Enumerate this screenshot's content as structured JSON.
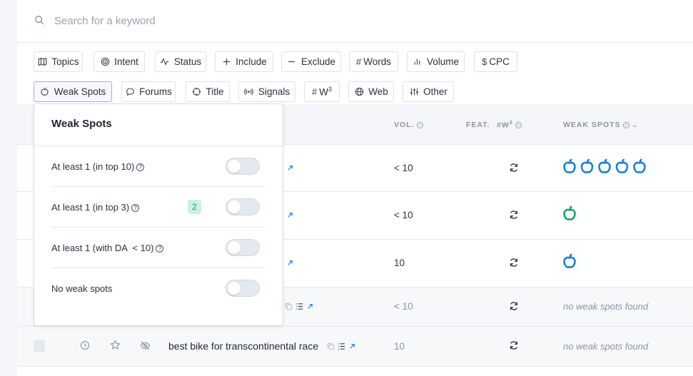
{
  "search": {
    "placeholder": "Search for a keyword"
  },
  "filters_row1": [
    {
      "label": "Topics",
      "icon": "map-icon"
    },
    {
      "label": "Intent",
      "icon": "target-icon"
    },
    {
      "label": "Status",
      "icon": "activity-icon"
    },
    {
      "label": "Include",
      "icon": "plus-icon"
    },
    {
      "label": "Exclude",
      "icon": "minus-icon"
    },
    {
      "label": "Words",
      "icon": "hash-icon"
    },
    {
      "label": "Volume",
      "icon": "bar-chart-icon"
    },
    {
      "label": "CPC",
      "icon": "dollar-icon"
    }
  ],
  "filters_row2": [
    {
      "label": "Weak Spots",
      "icon": "apple-icon"
    },
    {
      "label": "Forums",
      "icon": "chat-bubble-icon"
    },
    {
      "label": "Title",
      "icon": "crosshair-icon"
    },
    {
      "label": "Signals",
      "icon": "broadcast-icon"
    },
    {
      "label": "W",
      "sup": "3",
      "icon": "hash-icon"
    },
    {
      "label": "Web",
      "icon": "globe-icon"
    },
    {
      "label": "Other",
      "icon": "sliders-icon"
    }
  ],
  "table_headers": {
    "vol": "VOL.",
    "feat": "FEAT.",
    "w3": "#W",
    "w3_sup": "3",
    "weak_spots": "WEAK SPOTS"
  },
  "rows": [
    {
      "vol": "< 10",
      "weak_spots": {
        "count": 5,
        "color": "#1d7fd6"
      }
    },
    {
      "vol": "< 10",
      "weak_spots": {
        "count": 1,
        "color": "#1fa06e"
      }
    },
    {
      "vol": "10",
      "weak_spots": {
        "count": 1,
        "color": "#1d7fd6"
      }
    },
    {
      "vol": "< 10",
      "weak_spots_text": "no weak spots found"
    },
    {
      "keyword": "best bike for transcontinental race",
      "vol": "10",
      "weak_spots_text": "no weak spots found"
    }
  ],
  "dropdown": {
    "title": "Weak Spots",
    "options": [
      {
        "label": "At least 1 (in top 10)",
        "has_help": true,
        "badge": null,
        "enabled": false
      },
      {
        "label": "At least 1 (in top 3)",
        "has_help": true,
        "badge": "2",
        "enabled": false
      },
      {
        "label": "At least 1 (with DA  < 10)",
        "has_help": true,
        "badge": null,
        "enabled": false
      },
      {
        "label": "No weak spots",
        "has_help": false,
        "badge": null,
        "enabled": false
      }
    ]
  },
  "colors": {
    "weak_blue": "#1d7fd6",
    "weak_green": "#1fa06e",
    "link_blue": "#1d7fd6"
  }
}
